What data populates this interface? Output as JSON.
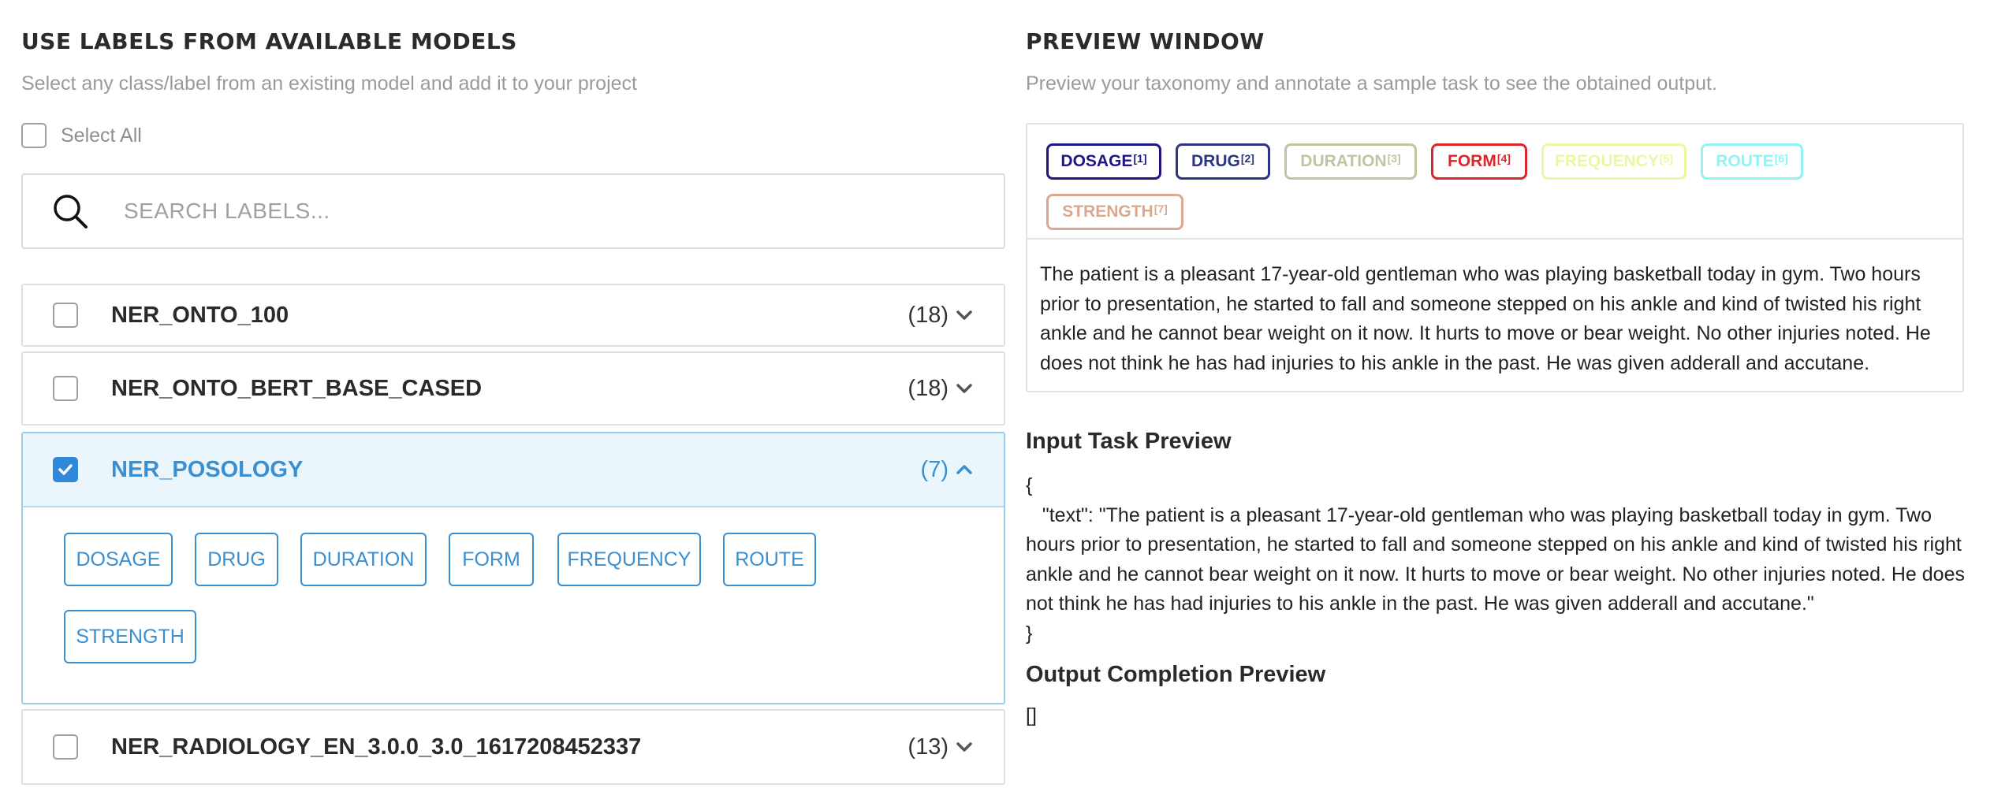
{
  "left": {
    "title": "USE LABELS FROM AVAILABLE MODELS",
    "subtitle": "Select any class/label from an existing model and add it to your project",
    "select_all_label": "Select All",
    "search_placeholder": "SEARCH LABELS...",
    "models": [
      {
        "name": "NER_ONTO_100",
        "count": "(18)",
        "checked": false,
        "expanded": false
      },
      {
        "name": "NER_ONTO_BERT_BASE_CASED",
        "count": "(18)",
        "checked": false,
        "expanded": false
      },
      {
        "name": "NER_POSOLOGY",
        "count": "(7)",
        "checked": true,
        "expanded": true,
        "labels": [
          "DOSAGE",
          "DRUG",
          "DURATION",
          "FORM",
          "FREQUENCY",
          "ROUTE",
          "STRENGTH"
        ]
      },
      {
        "name": "NER_RADIOLOGY_EN_3.0.0_3.0_1617208452337",
        "count": "(13)",
        "checked": false,
        "expanded": false
      }
    ]
  },
  "right": {
    "title": "PREVIEW WINDOW",
    "subtitle": "Preview your taxonomy and annotate a sample task to see the obtained output.",
    "tags": [
      {
        "label": "DOSAGE",
        "index": "[1]",
        "color": "#1d1685"
      },
      {
        "label": "DRUG",
        "index": "[2]",
        "color": "#2c3483"
      },
      {
        "label": "DURATION",
        "index": "[3]",
        "color": "#bfc5a1"
      },
      {
        "label": "FORM",
        "index": "[4]",
        "color": "#d8282c"
      },
      {
        "label": "FREQUENCY",
        "index": "[5]",
        "color": "#ecf7a1"
      },
      {
        "label": "ROUTE",
        "index": "[6]",
        "color": "#8ff4f2"
      },
      {
        "label": "STRENGTH",
        "index": "[7]",
        "color": "#d9a88e"
      }
    ],
    "preview_text": "The patient is a pleasant 17-year-old gentleman who was playing basketball today in gym. Two hours prior to presentation, he started to fall and someone stepped on his ankle and kind of twisted his right ankle and he cannot bear weight on it now. It hurts to move or bear weight. No other injuries noted. He does not think he has had injuries to his ankle in the past. He was given adderall and accutane.",
    "input_task_title": "Input Task Preview",
    "input_open": "{",
    "input_body": "   \"text\": \"The patient is a pleasant 17-year-old gentleman who was playing basketball today in gym. Two hours prior to presentation, he started to fall and someone stepped on his ankle and kind of twisted his right ankle and he cannot bear weight on it now. It hurts to move or bear weight. No other injuries noted. He does not think he has had injuries to his ankle in the past. He was given adderall and accutane.\"",
    "input_close": "}",
    "output_title": "Output Completion Preview",
    "output_value": "[]"
  }
}
